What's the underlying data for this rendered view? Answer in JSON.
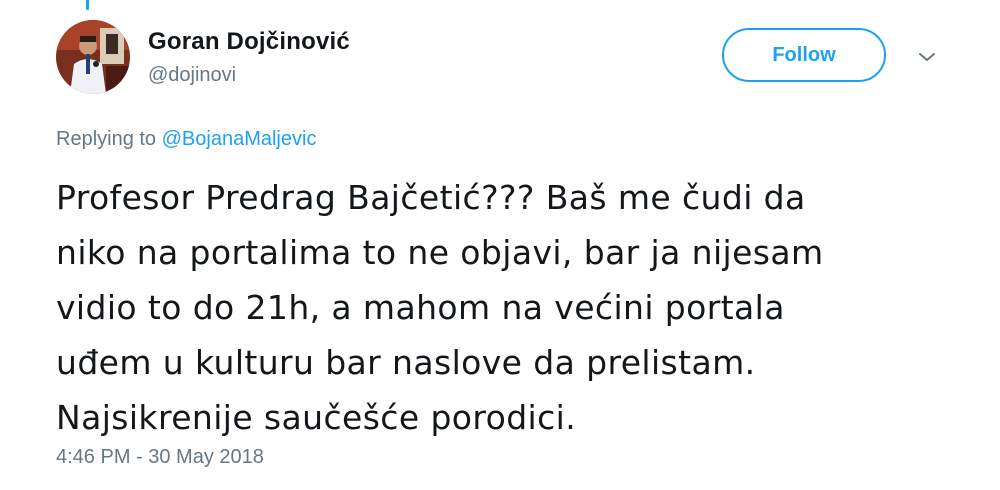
{
  "user": {
    "display_name": "Goran Dojčinović",
    "handle": "@dojinovi"
  },
  "follow_button": {
    "label": "Follow"
  },
  "menu": {
    "icon": "chevron-down-icon"
  },
  "reply": {
    "prefix": "Replying to",
    "mention": "@BojanaMaljevic"
  },
  "tweet": {
    "lines": [
      "Profesor Predrag Bajčetić??? Baš me čudi da",
      "niko na portalima to ne objavi, bar ja nijesam",
      "vidio to do 21h, a mahom na većini portala",
      "uđem u kulturu bar naslove da prelistam.",
      "Najsikrenije saučešće porodici."
    ]
  },
  "timestamp": "4:46 PM - 30 May 2018",
  "colors": {
    "accent": "#1da1f2",
    "text": "#14171a",
    "muted": "#657786"
  }
}
